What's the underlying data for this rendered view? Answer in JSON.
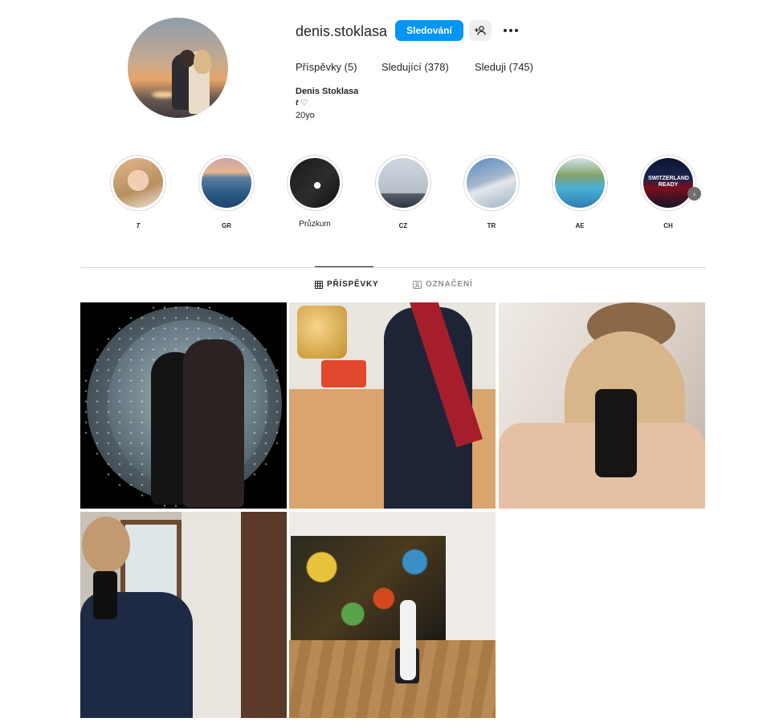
{
  "profile": {
    "username": "denis.stoklasa",
    "follow_label": "Sledování",
    "stats": {
      "posts": "Příspěvky (5)",
      "followers": "Sledující (378)",
      "following": "Sleduji (745)"
    },
    "full_name": "Denis Stoklasa",
    "bio_line": "t ♡",
    "bio_age": "20yo"
  },
  "highlights": [
    {
      "label": "T",
      "icon": "story-highlight"
    },
    {
      "label": "GR",
      "icon": "story-highlight"
    },
    {
      "label": "Průzkum",
      "icon": "story-highlight"
    },
    {
      "label": "CZ",
      "icon": "story-highlight"
    },
    {
      "label": "TR",
      "icon": "story-highlight"
    },
    {
      "label": "AE",
      "icon": "story-highlight"
    },
    {
      "label": "CH",
      "icon": "story-highlight",
      "overlay_text": "SWITZERLAND READY"
    }
  ],
  "tabs": {
    "posts": "PŘÍSPĚVKY",
    "tagged": "OZNAČENÍ"
  },
  "colors": {
    "accent": "#0095f6",
    "text": "#262626",
    "muted": "#8e8e8e",
    "divider": "#dbdbdb"
  }
}
